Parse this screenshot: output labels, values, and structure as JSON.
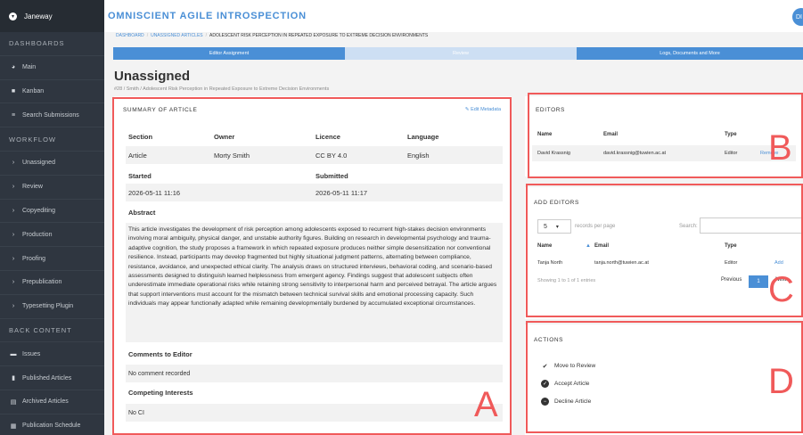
{
  "sidebar": {
    "brand": "Janeway",
    "dashboards_head": "DASHBOARDS",
    "main": "Main",
    "kanban": "Kanban",
    "search": "Search Submissions",
    "workflow_head": "WORKFLOW",
    "workflow": [
      "Unassigned",
      "Review",
      "Copyediting",
      "Production",
      "Proofing",
      "Prepublication",
      "Typesetting Plugin"
    ],
    "back_head": "BACK CONTENT",
    "issues": "Issues",
    "published": "Published Articles",
    "archived": "Archived Articles",
    "schedule": "Publication Schedule"
  },
  "topbar": {
    "title": "OMNISCIENT AGILE INTROSPECTION",
    "avatar": "DI"
  },
  "breadcrumb": {
    "dashboard": "DASHBOARD",
    "unassigned": "UNASSIGNED ARTICLES",
    "current": "ADOLESCENT RISK PERCEPTION IN REPEATED EXPOSURE TO EXTREME DECISION ENVIRONMENTS"
  },
  "progress": {
    "t1": "Editor Assignment",
    "t2": "Review",
    "t3": "Logs, Documents and More"
  },
  "page": {
    "title": "Unassigned",
    "subtitle": "#28 / Smith / Adolescent Risk Perception in Repeated Exposure to Extreme Decision Environments"
  },
  "summary": {
    "header": "SUMMARY OF ARTICLE",
    "edit": "Edit Metadata",
    "h_section": "Section",
    "h_owner": "Owner",
    "h_licence": "Licence",
    "h_language": "Language",
    "v_section": "Article",
    "v_owner": "Morty Smith",
    "v_licence": "CC BY 4.0",
    "v_language": "English",
    "h_started": "Started",
    "h_submitted": "Submitted",
    "v_started": "2026-05-11 11:16",
    "v_submitted": "2026-05-11 11:17",
    "abstract_label": "Abstract",
    "abstract": "This article investigates the development of risk perception among adolescents exposed to recurrent high-stakes decision environments involving moral ambiguity, physical danger, and unstable authority figures. Building on research in developmental psychology and trauma-adaptive cognition, the study proposes a framework in which repeated exposure produces neither simple desensitization nor conventional resilience. Instead, participants may develop fragmented but highly situational judgment patterns, alternating between compliance, resistance, avoidance, and unexpected ethical clarity. The analysis draws on structured interviews, behavioral coding, and scenario-based assessments designed to distinguish learned helplessness from emergent agency. Findings suggest that adolescent subjects often underestimate immediate operational risks while retaining strong sensitivity to interpersonal harm and perceived betrayal. The article argues that support interventions must account for the mismatch between technical survival skills and emotional processing capacity. Such individuals may appear functionally adapted while remaining developmentally burdened by accumulated exceptional circumstances.",
    "comments_label": "Comments to Editor",
    "comments_value": "No comment recorded",
    "ci_label": "Competing Interests",
    "ci_value": "No CI"
  },
  "editors": {
    "header": "EDITORS",
    "h_name": "Name",
    "h_email": "Email",
    "h_type": "Type",
    "rows": [
      {
        "name": "David Krassnig",
        "email": "david.krassnig@tuwien.ac.at",
        "type": "Editor",
        "action": "Remove"
      }
    ]
  },
  "add_editors": {
    "header": "ADD EDITORS",
    "page_size": "5",
    "records_label": "records per page",
    "search_label": "Search:",
    "h_name": "Name",
    "h_email": "Email",
    "h_type": "Type",
    "rows": [
      {
        "name": "Tanja North",
        "email": "tanja.north@tuwien.ac.at",
        "type": "Editor",
        "action": "Add"
      }
    ],
    "info": "Showing 1 to 1 of 1 entries",
    "prev": "Previous",
    "page": "1",
    "next": "Next"
  },
  "actions": {
    "header": "ACTIONS",
    "items": [
      "Move to Review",
      "Accept Article",
      "Decline Article"
    ]
  },
  "markers": {
    "a": "A",
    "b": "B",
    "c": "C",
    "d": "D",
    "color": "#f05a5a"
  }
}
